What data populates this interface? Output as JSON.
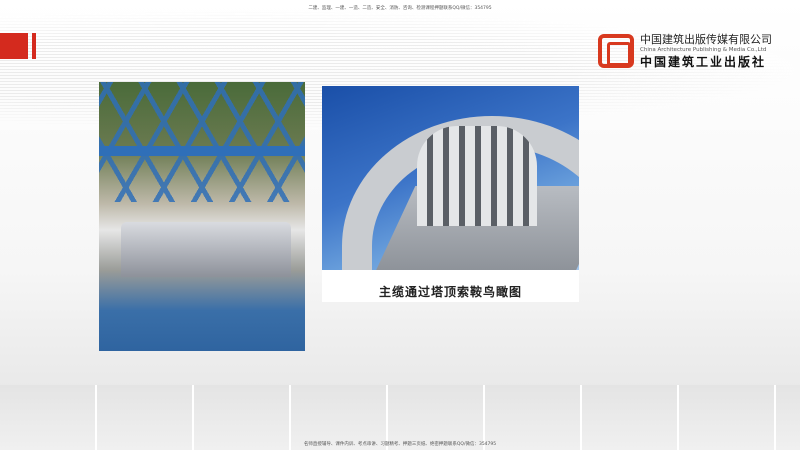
{
  "header": {
    "top_text": "二建、监理、一建、一造、二造、安全、消防、咨询、检测课程押题联系QQ/微信：354795"
  },
  "logo": {
    "name_cn": "中国建筑出版传媒有限公司",
    "name_en": "China Architecture Publishing & Media Co.,Ltd",
    "name_calligraphy": "中国建筑工业出版社"
  },
  "slide": {
    "caption": "主缆通过塔顶索鞍鸟瞰图"
  },
  "footer": {
    "bottom_text": "名师直授辅导、课件内训、考点串讲、习题精考、押题三页纸、绝密押题联系QQ/微信：354795"
  },
  "colors": {
    "accent": "#d42a1e"
  }
}
